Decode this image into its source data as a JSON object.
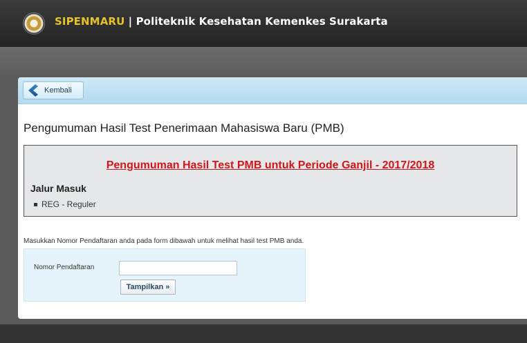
{
  "header": {
    "brand": "SIPENMARU",
    "separator": " | ",
    "institution": "Politeknik Kesehatan Kemenkes Surakarta"
  },
  "toolbar": {
    "back_label": "Kembali"
  },
  "main": {
    "heading": "Pengumuman Hasil Test Penerimaan Mahasiswa Baru (PMB)",
    "announcement": {
      "link_text": "Pengumuman Hasil Test PMB untuk Periode Ganjil - 2017/2018",
      "jalur_title": "Jalur Masuk",
      "jalur_items": [
        "REG - Reguler"
      ]
    },
    "instruction": "Masukkan Nomor Pendaftaran anda pada form dibawah untuk melihat hasil test PMB anda.",
    "form": {
      "field_label": "Nomor Pendaftaran",
      "field_value": "",
      "submit_label": "Tampilkan »"
    }
  },
  "colors": {
    "accent_brand": "#e6c229",
    "link_red": "#d1161c",
    "toolbar_blue": "#b3dbf1",
    "form_bg": "#e5f4fb"
  }
}
